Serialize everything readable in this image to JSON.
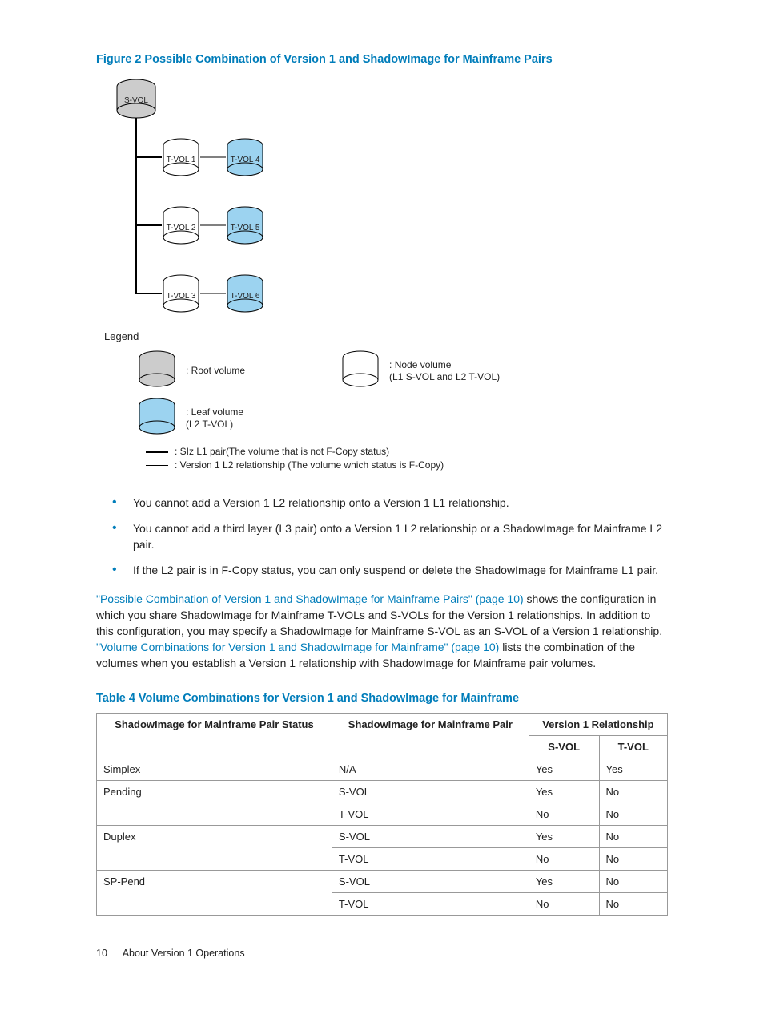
{
  "figure_title": "Figure 2 Possible Combination of Version 1 and ShadowImage for Mainframe Pairs",
  "diagram": {
    "svol": "S-VOL",
    "tvol1": "T-VOL\n1",
    "tvol2": "T-VOL\n2",
    "tvol3": "T-VOL\n3",
    "tvol4": "T-VOL\n4",
    "tvol5": "T-VOL\n5",
    "tvol6": "T-VOL\n6"
  },
  "legend": {
    "title": "Legend",
    "root": ": Root volume",
    "node": ": Node volume\n(L1 S-VOL and L2 T-VOL)",
    "leaf": ": Leaf volume\n(L2 T-VOL)",
    "line_l1": ": SIz L1 pair(The volume that is not F-Copy status)",
    "line_l2": ": Version 1 L2 relationship (The volume which status is F-Copy)"
  },
  "bullets": [
    "You cannot add a Version 1 L2 relationship onto a Version 1 L1 relationship.",
    "You cannot add a third layer (L3 pair) onto a Version 1 L2 relationship or a ShadowImage for Mainframe L2 pair.",
    "If the L2 pair is in F-Copy status, you can only suspend or delete the ShadowImage for Mainframe L1 pair."
  ],
  "para": {
    "p1a": "\"Possible Combination of Version 1 and ShadowImage for Mainframe Pairs\" (page 10)",
    "p1b": " shows the configuration in which you share ShadowImage for Mainframe T-VOLs and S-VOLs for the Version 1 relationships. In addition to this configuration, you may specify a ShadowImage for Mainframe S-VOL as an S-VOL of a Version 1 relationship. ",
    "p1c": "\"Volume Combinations for Version 1 and ShadowImage for Mainframe\" (page 10)",
    "p1d": " lists the combination of the volumes when you establish a Version 1 relationship with ShadowImage for Mainframe pair volumes."
  },
  "table_title": "Table 4 Volume Combinations for Version 1 and ShadowImage for Mainframe",
  "table": {
    "h1": "ShadowImage for Mainframe Pair Status",
    "h2": "ShadowImage for Mainframe Pair",
    "h3": "Version 1 Relationship",
    "h3a": "S-VOL",
    "h3b": "T-VOL",
    "rows": [
      {
        "c1": "Simplex",
        "c2": "N/A",
        "c3": "Yes",
        "c4": "Yes"
      },
      {
        "c1": "Pending",
        "c2": "S-VOL",
        "c3": "Yes",
        "c4": "No"
      },
      {
        "c1": "",
        "c2": "T-VOL",
        "c3": "No",
        "c4": "No"
      },
      {
        "c1": "Duplex",
        "c2": "S-VOL",
        "c3": "Yes",
        "c4": "No"
      },
      {
        "c1": "",
        "c2": "T-VOL",
        "c3": "No",
        "c4": "No"
      },
      {
        "c1": "SP-Pend",
        "c2": "S-VOL",
        "c3": "Yes",
        "c4": "No"
      },
      {
        "c1": "",
        "c2": "T-VOL",
        "c3": "No",
        "c4": "No"
      }
    ]
  },
  "footer": {
    "page": "10",
    "section": "About Version 1 Operations"
  }
}
